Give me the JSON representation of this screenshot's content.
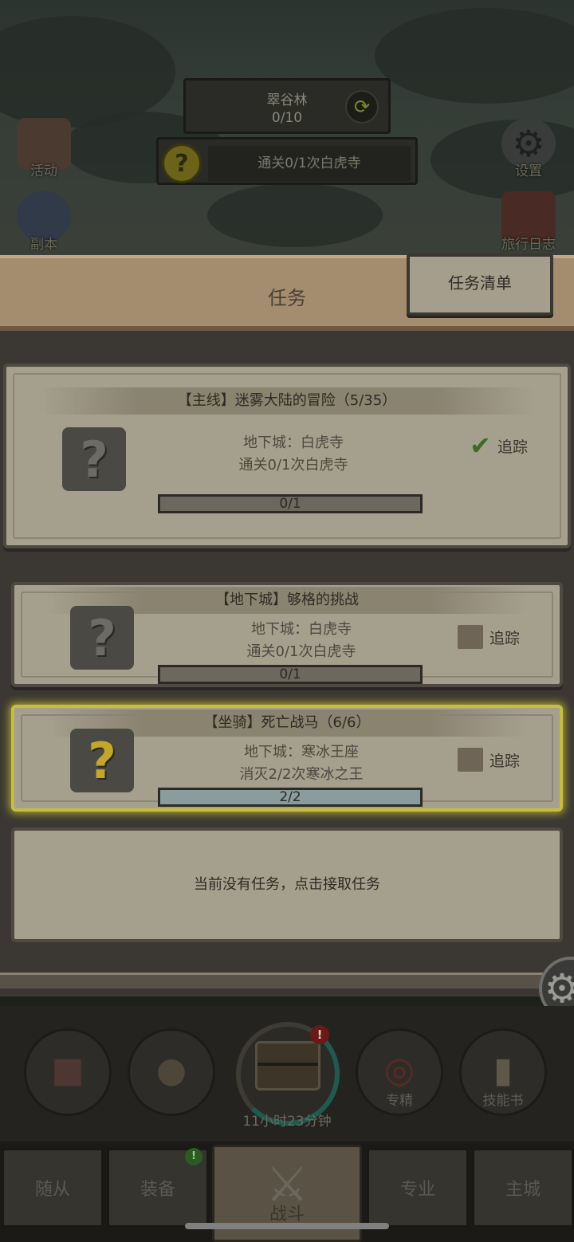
{
  "hud": {
    "zone_name": "翠谷林",
    "zone_progress": "0/10",
    "quest_hint": "通关0/1次白虎寺"
  },
  "side_buttons": {
    "activity": "活动",
    "dungeon": "副本",
    "settings": "设置",
    "travel_log": "旅行日志"
  },
  "panel": {
    "title": "任务",
    "list_tab": "任务清单"
  },
  "quests": [
    {
      "title": "【主线】迷雾大陆的冒险（5/35）",
      "location": "地下城：白虎寺",
      "objective": "通关0/1次白虎寺",
      "progress_text": "0/1",
      "progress": 0,
      "track_label": "追踪",
      "tracked": true
    },
    {
      "title": "【地下城】够格的挑战",
      "location": "地下城：白虎寺",
      "objective": "通关0/1次白虎寺",
      "progress_text": "0/1",
      "progress": 0,
      "track_label": "追踪",
      "tracked": false
    },
    {
      "title": "【坐骑】死亡战马（6/6）",
      "location": "地下城：寒冰王座",
      "objective": "消灭2/2次寒冰之王",
      "progress_text": "2/2",
      "progress": 1,
      "track_label": "追踪",
      "tracked": false
    }
  ],
  "empty_slot": "当前没有任务，点击接取任务",
  "actions": {
    "timer": "11小时23分钟",
    "badge": "!",
    "specialize": "专精",
    "skill_book": "技能书"
  },
  "nav": {
    "followers": "随从",
    "equipment": "装备",
    "battle": "战斗",
    "profession": "专业",
    "main_city": "主城",
    "equipment_badge": "!"
  },
  "colors": {
    "card_bg": "#a59f8d",
    "active_border": "#c6bd42",
    "progress_fill": "#8a9ca0",
    "track_check": "#3d6a2a"
  }
}
